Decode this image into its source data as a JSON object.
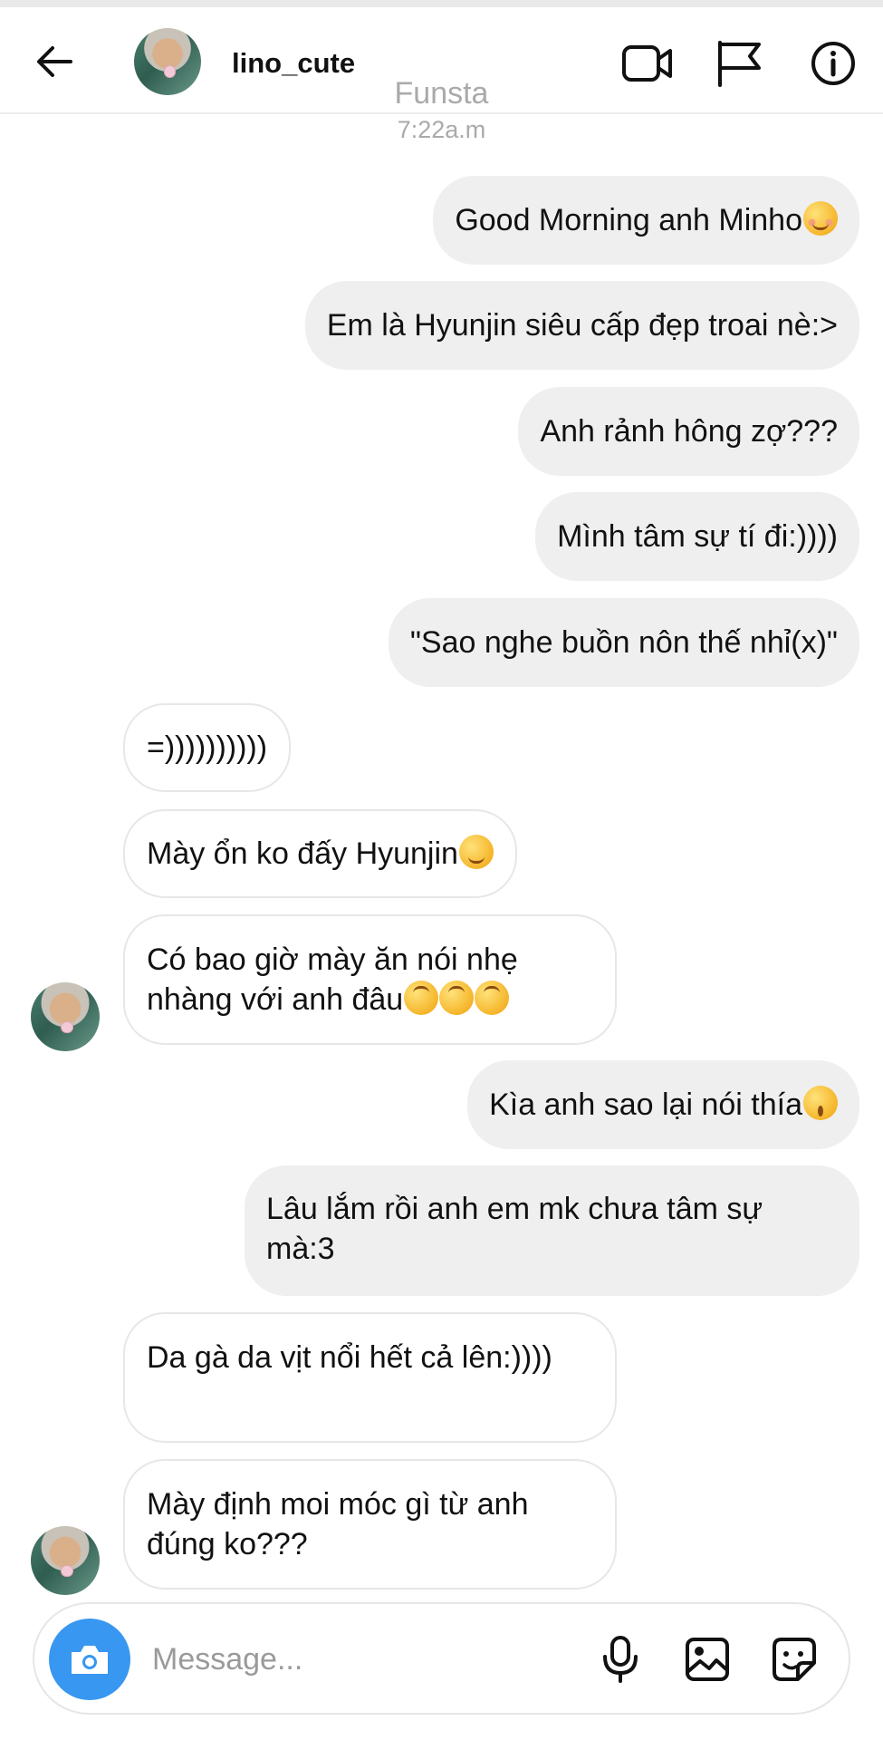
{
  "header": {
    "username": "lino_cute",
    "icons": {
      "back": "arrow-left-icon",
      "video": "video-camera-icon",
      "flag": "flag-icon",
      "info": "info-icon"
    }
  },
  "watermark": {
    "title": "Funsta",
    "time": "7:22a.m"
  },
  "messages": [
    {
      "side": "out",
      "text": "Good Morning anh Minho",
      "emoji": [
        "smiling-face-blush"
      ]
    },
    {
      "side": "out",
      "text": "Em là Hyunjin siêu cấp đẹp troai nè:>"
    },
    {
      "side": "out",
      "text": "Anh rảnh hông zợ???"
    },
    {
      "side": "out",
      "text": "Mình tâm sự tí đi:))))"
    },
    {
      "side": "out",
      "text": "\"Sao nghe buồn nôn thế nhỉ(x)\""
    },
    {
      "side": "in",
      "text": "=))))))))))"
    },
    {
      "side": "in",
      "text": "Mày ổn ko đấy Hyunjin",
      "emoji": [
        "slightly-smiling-face"
      ]
    },
    {
      "side": "in",
      "text": "Có bao giờ mày ăn nói nhẹ nhàng với anh đâu",
      "emoji": [
        "upside-down-face",
        "upside-down-face",
        "upside-down-face"
      ]
    },
    {
      "side": "out",
      "text": "Kìa anh sao lại nói thía",
      "emoji": [
        "kissing-face"
      ]
    },
    {
      "side": "out",
      "text": "Lâu lắm rồi anh em mk chưa tâm sự mà:3"
    },
    {
      "side": "in",
      "text": "Da gà da vịt nổi hết cả lên:))))"
    },
    {
      "side": "in",
      "text": "Mày định moi móc gì từ anh đúng ko???"
    }
  ],
  "composer": {
    "placeholder": "Message...",
    "value": "",
    "icons": {
      "camera": "camera-icon",
      "mic": "microphone-icon",
      "gallery": "image-icon",
      "sticker": "sticker-icon"
    }
  },
  "colors": {
    "outgoing_bubble": "#efefef",
    "incoming_border": "#e7e7e7",
    "accent": "#3897f0",
    "muted_text": "#aaaaaa"
  }
}
